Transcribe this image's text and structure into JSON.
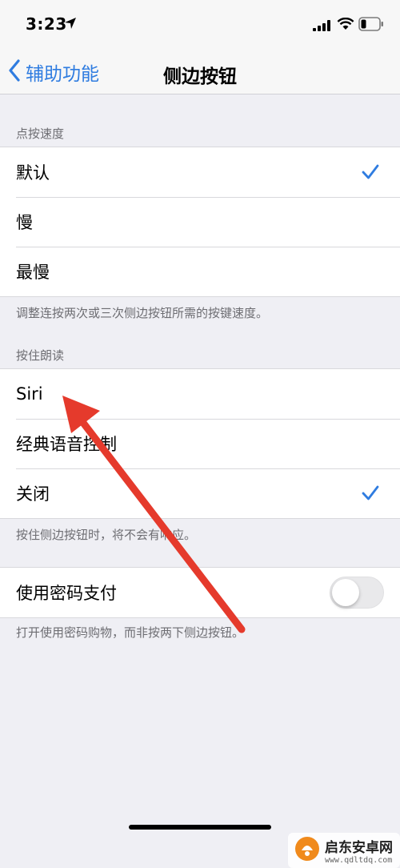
{
  "status_bar": {
    "time": "3:23",
    "icons": [
      "location-arrow-icon",
      "signal-icon",
      "wifi-icon",
      "battery-icon"
    ]
  },
  "nav": {
    "back_label": "辅助功能",
    "title": "侧边按钮",
    "accent_color": "#2f7ce0"
  },
  "sections": [
    {
      "header": "点按速度",
      "rows": [
        {
          "label": "默认",
          "checked": true
        },
        {
          "label": "慢",
          "checked": false
        },
        {
          "label": "最慢",
          "checked": false
        }
      ],
      "footer": "调整连按两次或三次侧边按钮所需的按键速度。"
    },
    {
      "header": "按住朗读",
      "rows": [
        {
          "label": "Siri",
          "checked": false
        },
        {
          "label": "经典语音控制",
          "checked": false
        },
        {
          "label": "关闭",
          "checked": true
        }
      ],
      "footer": "按住侧边按钮时，将不会有响应。"
    },
    {
      "rows": [
        {
          "label": "使用密码支付",
          "toggle_on": false
        }
      ],
      "footer": "打开使用密码购物，而非按两下侧边按钮。"
    }
  ],
  "annotation": {
    "type": "red-arrow",
    "color": "#e53a2c"
  },
  "watermark": {
    "brand": "启东安卓网",
    "url": "www.qdltdq.com"
  }
}
